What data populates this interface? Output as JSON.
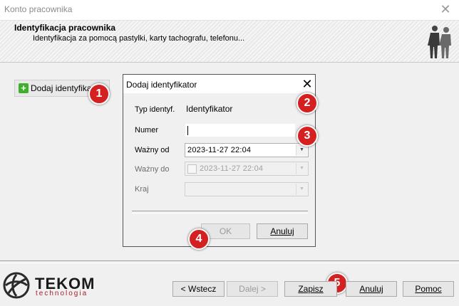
{
  "window": {
    "title": "Konto pracownika",
    "close_glyph": "✕"
  },
  "header": {
    "title": "Identyfikacja pracownika",
    "subtitle": "Identyfikacja za pomocą pastylki, karty tachografu, telefonu..."
  },
  "main": {
    "add_identifier_label": "Dodaj identyfikator",
    "plus_glyph": "+"
  },
  "dialog": {
    "title": "Dodaj identyfikator",
    "close_glyph": "✕",
    "fields": {
      "type": {
        "label": "Typ identyf.",
        "value": "Identyfikator"
      },
      "number": {
        "label": "Numer",
        "value": ""
      },
      "valid_from": {
        "label": "Ważny od",
        "value": "2023-11-27 22:04"
      },
      "valid_to": {
        "label": "Ważny do",
        "value": "2023-11-27 22:04",
        "checked": false
      },
      "country": {
        "label": "Kraj",
        "value": ""
      }
    },
    "ok_label": "OK",
    "cancel_label": "Anuluj"
  },
  "callouts": [
    "1",
    "2",
    "3",
    "4",
    "5"
  ],
  "footer": {
    "logo_name": "TEKOM",
    "logo_sub": "technologia",
    "back_label": "< Wstecz",
    "next_label": "Dalej >",
    "save_label": "Zapisz",
    "cancel_label": "Anuluj",
    "help_label": "Pomoc"
  },
  "colors": {
    "callout": "#d42020",
    "logo_accent": "#a81e2b",
    "add_icon": "#3fae2a"
  }
}
